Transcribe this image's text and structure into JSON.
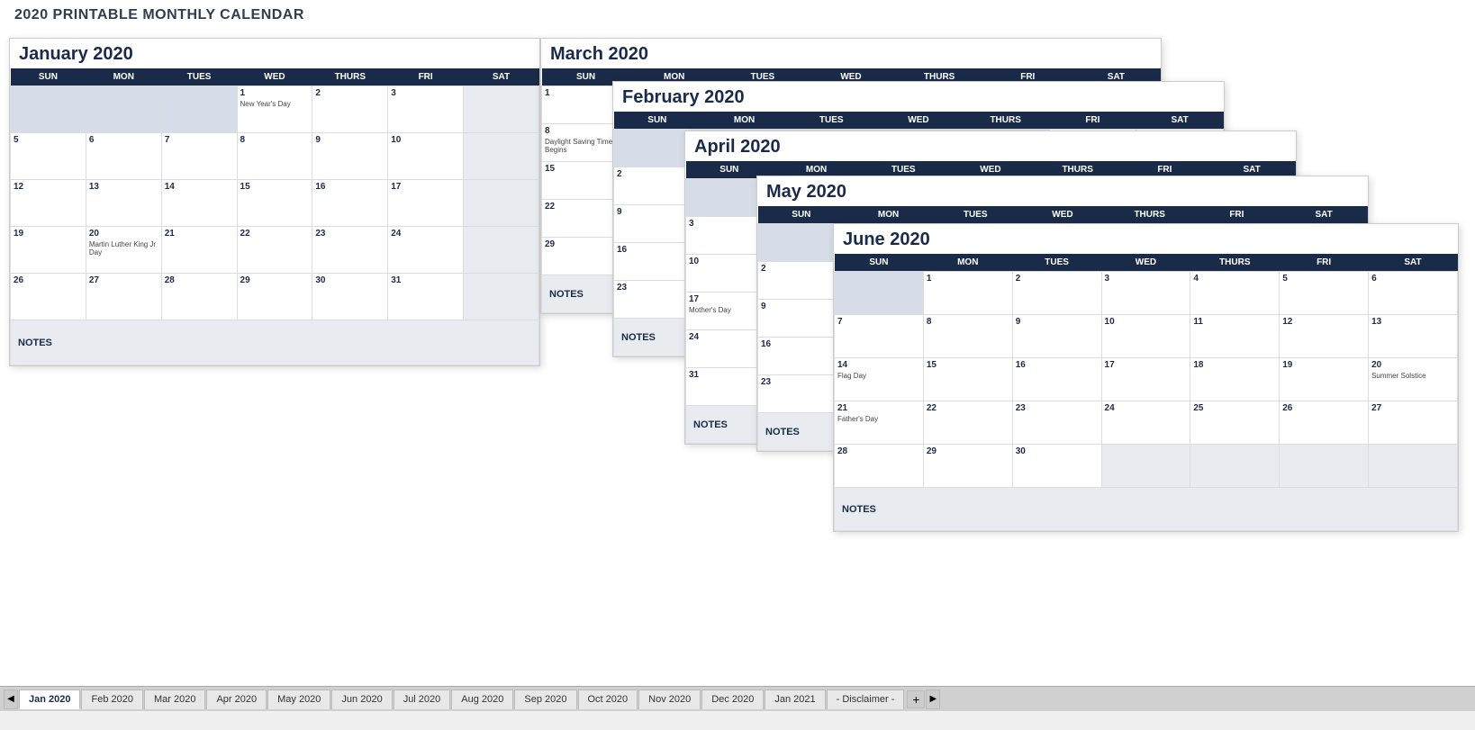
{
  "page": {
    "title": "2020 PRINTABLE MONTHLY CALENDAR"
  },
  "tabs": [
    {
      "label": "Jan 2020",
      "active": true
    },
    {
      "label": "Feb 2020",
      "active": false
    },
    {
      "label": "Mar 2020",
      "active": false
    },
    {
      "label": "Apr 2020",
      "active": false
    },
    {
      "label": "May 2020",
      "active": false
    },
    {
      "label": "Jun 2020",
      "active": false
    },
    {
      "label": "Jul 2020",
      "active": false
    },
    {
      "label": "Aug 2020",
      "active": false
    },
    {
      "label": "Sep 2020",
      "active": false
    },
    {
      "label": "Oct 2020",
      "active": false
    },
    {
      "label": "Nov 2020",
      "active": false
    },
    {
      "label": "Dec 2020",
      "active": false
    },
    {
      "label": "Jan 2021",
      "active": false
    },
    {
      "label": "- Disclaimer -",
      "active": false
    }
  ],
  "calendars": {
    "january": {
      "title": "January 2020",
      "notes_label": "NOTES"
    },
    "march": {
      "title": "March 2020"
    },
    "february": {
      "title": "February 2020"
    },
    "april": {
      "title": "April 2020"
    },
    "may": {
      "title": "May 2020"
    },
    "june": {
      "title": "June 2020",
      "notes_label": "NOTES"
    }
  }
}
